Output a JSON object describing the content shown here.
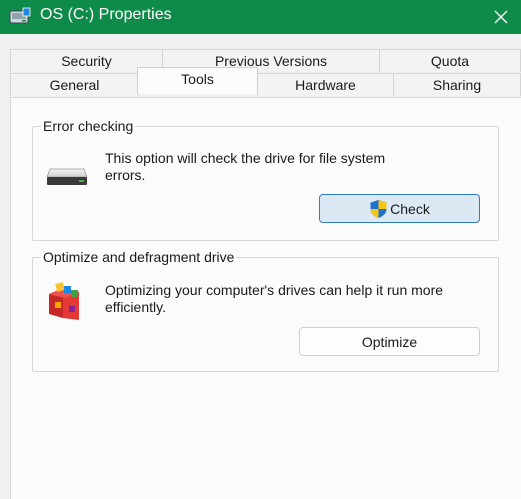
{
  "window": {
    "title": "OS (C:) Properties",
    "close_icon": "close-icon",
    "app_icon": "drive-properties-icon"
  },
  "tabs": {
    "row1": [
      {
        "label": "Security"
      },
      {
        "label": "Previous Versions"
      },
      {
        "label": "Quota"
      }
    ],
    "row2": [
      {
        "label": "General"
      },
      {
        "label": "Tools",
        "active": true
      },
      {
        "label": "Hardware"
      },
      {
        "label": "Sharing"
      }
    ]
  },
  "error_checking": {
    "title": "Error checking",
    "description": "This option will check the drive for file system errors.",
    "icon": "hard-drive-icon",
    "button_label": "Check",
    "button_icon": "uac-shield-icon"
  },
  "optimize": {
    "title": "Optimize and defragment drive",
    "description": "Optimizing your computer's drives can help it run more efficiently.",
    "icon": "defrag-icon",
    "button_label": "Optimize"
  },
  "colors": {
    "titlebar": "#0e8a49",
    "primary_button_border": "#2c7cc2",
    "primary_button_fill": "#dce9f4"
  }
}
